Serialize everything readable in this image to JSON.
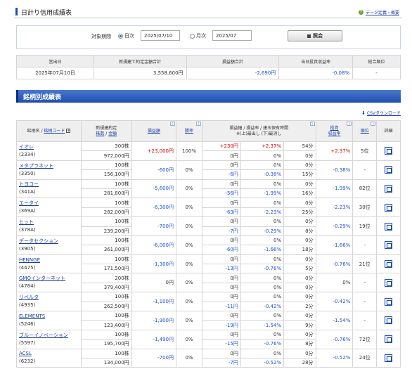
{
  "header": {
    "title": "日計り信用成績表",
    "help_icon": "?",
    "help_link": "データ定義・概要"
  },
  "filter": {
    "period_label": "対象期間",
    "daily_label": "日次",
    "daily_value": "2025/07/10",
    "daily_selected": true,
    "monthly_label": "月次",
    "monthly_value": "2025/07",
    "submit_label": "照会"
  },
  "summary": {
    "headers": [
      "営出日",
      "新規建て約定金額合計",
      "損益額合計",
      "当日投資収益率",
      "総合順位"
    ],
    "row": [
      "2025年07月10日",
      "3,558,600円",
      "-2,690円",
      "-0.08%",
      "-"
    ]
  },
  "section_title": "銘柄別成績表",
  "csv_link": "CSVダウンロード",
  "grid": {
    "headers": {
      "name": "銘柄名",
      "code": "銘柄コード",
      "contract_l1": "新規建約定",
      "contract_qty": "株数",
      "contract_amt": "金額",
      "pl": "損益額",
      "win": "勝率",
      "range_l1": "損益幅 / 損益率 / 建玉保有時間",
      "range_l2": "※(上)最出し (下)最消し",
      "ret_l1": "投資",
      "ret_l2": "収益率",
      "rank": "順位",
      "detail": "詳細"
    },
    "help_icon": "?",
    "rows": [
      {
        "name": "イオレ",
        "code": "(2334)",
        "qty": "300株",
        "amt": "972,000円",
        "pl": "+23,000円",
        "win": "100%",
        "max_pl": "+230円",
        "max_rate": "+2.37%",
        "max_time": "54分",
        "min_pl": "0円",
        "min_rate": "0%",
        "min_time": "0分",
        "ret": "+2.37%",
        "rank": "5位"
      },
      {
        "name": "メタプラネット",
        "code": "(3350)",
        "qty": "100株",
        "amt": "156,100円",
        "pl": "-600円",
        "win": "0%",
        "max_pl": "0円",
        "max_rate": "0%",
        "max_time": "0分",
        "min_pl": "-6円",
        "min_rate": "-0.38%",
        "min_time": "15分",
        "ret": "-0.38%",
        "rank": "-"
      },
      {
        "name": "トヨコー",
        "code": "(341A)",
        "qty": "100株",
        "amt": "281,800円",
        "pl": "-5,600円",
        "win": "0%",
        "max_pl": "0円",
        "max_rate": "0%",
        "max_time": "0分",
        "min_pl": "-56円",
        "min_rate": "-1.99%",
        "min_time": "16分",
        "ret": "-1.99%",
        "rank": "82位"
      },
      {
        "name": "エータイ",
        "code": "(369A)",
        "qty": "100株",
        "amt": "282,000円",
        "pl": "-6,300円",
        "win": "0%",
        "max_pl": "0円",
        "max_rate": "0%",
        "max_time": "0分",
        "min_pl": "-63円",
        "min_rate": "-2.23%",
        "min_time": "25分",
        "ret": "-2.23%",
        "rank": "30位"
      },
      {
        "name": "ヒット",
        "code": "(378A)",
        "qty": "100株",
        "amt": "239,200円",
        "pl": "-700円",
        "win": "0%",
        "max_pl": "0円",
        "max_rate": "0%",
        "max_time": "0分",
        "min_pl": "-7円",
        "min_rate": "-0.29%",
        "min_time": "8分",
        "ret": "-0.29%",
        "rank": "19位"
      },
      {
        "name": "データセクション",
        "code": "(3905)",
        "qty": "100株",
        "amt": "361,000円",
        "pl": "-6,000円",
        "win": "0%",
        "max_pl": "0円",
        "max_rate": "0%",
        "max_time": "0分",
        "min_pl": "-60円",
        "min_rate": "-1.66%",
        "min_time": "18分",
        "ret": "-1.66%",
        "rank": "-"
      },
      {
        "name": "HENNGE",
        "code": "(4475)",
        "qty": "100株",
        "amt": "171,500円",
        "pl": "-1,300円",
        "win": "0%",
        "max_pl": "0円",
        "max_rate": "0%",
        "max_time": "0分",
        "min_pl": "-13円",
        "min_rate": "-0.76%",
        "min_time": "5分",
        "ret": "-0.76%",
        "rank": "21位"
      },
      {
        "name": "GMOインターネット",
        "code": "(4784)",
        "qty": "200株",
        "amt": "379,400円",
        "pl": "0円",
        "win": "0%",
        "max_pl": "0円",
        "max_rate": "0%",
        "max_time": "0分",
        "min_pl": "0円",
        "min_rate": "0%",
        "min_time": "0分",
        "ret": "0%",
        "rank": "-"
      },
      {
        "name": "リベルタ",
        "code": "(4935)",
        "qty": "100株",
        "amt": "262,500円",
        "pl": "-1,100円",
        "win": "0%",
        "max_pl": "0円",
        "max_rate": "0%",
        "max_time": "0分",
        "min_pl": "-11円",
        "min_rate": "-0.42%",
        "min_time": "2分",
        "ret": "-0.42%",
        "rank": "-"
      },
      {
        "name": "ELEMENTS",
        "code": "(5246)",
        "qty": "100株",
        "amt": "123,400円",
        "pl": "-1,900円",
        "win": "0%",
        "max_pl": "0円",
        "max_rate": "0%",
        "max_time": "0分",
        "min_pl": "-19円",
        "min_rate": "-1.54%",
        "min_time": "9分",
        "ret": "-1.54%",
        "rank": "-"
      },
      {
        "name": "ブルーイノベーション",
        "code": "(5597)",
        "qty": "100株",
        "amt": "195,700円",
        "pl": "-1,490円",
        "win": "0%",
        "max_pl": "0円",
        "max_rate": "0%",
        "max_time": "0分",
        "min_pl": "-15円",
        "min_rate": "-0.76%",
        "min_time": "8分",
        "ret": "-0.76%",
        "rank": "72位"
      },
      {
        "name": "ACSL",
        "code": "(6232)",
        "qty": "100株",
        "amt": "134,000円",
        "pl": "-700円",
        "win": "0%",
        "max_pl": "0円",
        "max_rate": "0%",
        "max_time": "0分",
        "min_pl": "-7円",
        "min_rate": "-0.52%",
        "min_time": "28分",
        "ret": "-0.52%",
        "rank": "24位"
      }
    ]
  },
  "colors": {
    "positive": "#e00000",
    "negative": "#1e4fe0",
    "accent": "#1e4fae"
  }
}
